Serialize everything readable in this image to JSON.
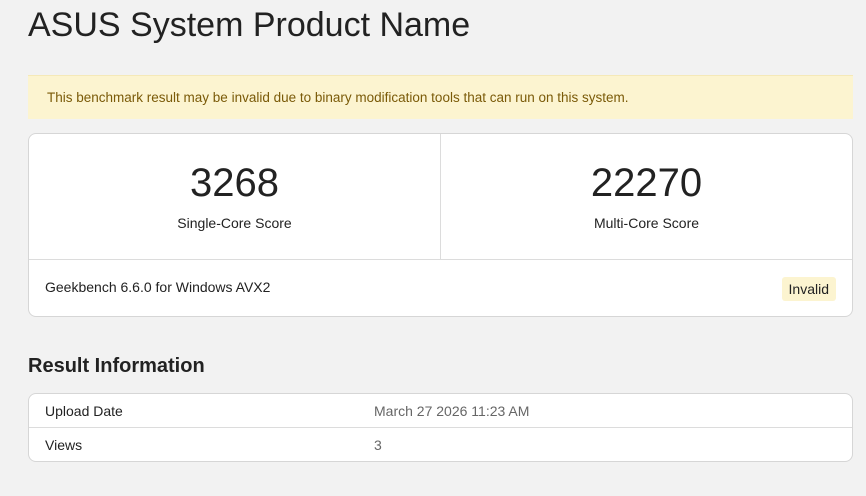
{
  "page": {
    "title": "ASUS System Product Name"
  },
  "warning": {
    "text": "This benchmark result may be invalid due to binary modification tools that can run on this system."
  },
  "scores": {
    "single_core": {
      "value": "3268",
      "label": "Single-Core Score"
    },
    "multi_core": {
      "value": "22270",
      "label": "Multi-Core Score"
    },
    "version": "Geekbench 6.6.0 for Windows AVX2",
    "badge": "Invalid"
  },
  "result_info": {
    "title": "Result Information",
    "rows": [
      {
        "key": "Upload Date",
        "value": "March 27 2026 11:23 AM"
      },
      {
        "key": "Views",
        "value": "3"
      }
    ]
  },
  "colors": {
    "background": "#f2f2f2",
    "warning_background": "#fcf4d0",
    "warning_text": "#7a5a08",
    "card_background": "#ffffff",
    "border": "#d6d6d6"
  }
}
